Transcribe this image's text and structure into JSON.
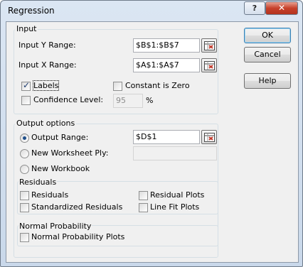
{
  "window": {
    "title": "Regression",
    "help_glyph": "?",
    "close_glyph": "✕"
  },
  "input": {
    "legend": "Input",
    "y_range_label": "Input Y Range:",
    "y_range_value": "$B$1:$B$7",
    "x_range_label": "Input X Range:",
    "x_range_value": "$A$1:$A$7",
    "labels_label": "Labels",
    "labels_checked": true,
    "constant_zero_label": "Constant is Zero",
    "constant_zero_checked": false,
    "confidence_label": "Confidence Level:",
    "confidence_checked": false,
    "confidence_value": "95",
    "percent_sign": "%"
  },
  "output": {
    "legend": "Output options",
    "output_range_label": "Output Range:",
    "output_range_value": "$D$1",
    "new_ply_label": "New Worksheet Ply:",
    "new_ply_value": "",
    "new_workbook_label": "New Workbook",
    "selected": "output_range"
  },
  "residuals": {
    "legend": "Residuals",
    "residuals_label": "Residuals",
    "standardized_label": "Standardized Residuals",
    "residual_plots_label": "Residual Plots",
    "line_fit_label": "Line Fit Plots"
  },
  "normal": {
    "legend": "Normal Probability",
    "plots_label": "Normal Probability Plots"
  },
  "buttons": {
    "ok": "OK",
    "cancel": "Cancel",
    "help": "Help"
  },
  "icons": {
    "collapse": "range-collapse-icon"
  }
}
